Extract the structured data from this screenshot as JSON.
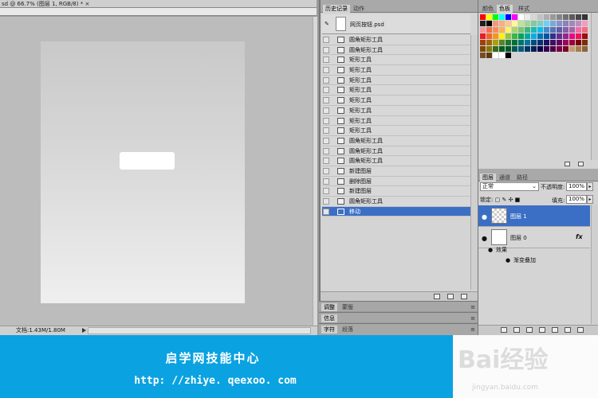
{
  "document": {
    "title": "sd @ 66.7% (图层 1, RGB/8) *",
    "close_glyph": "×",
    "status": "文档:1.43M/1.80M"
  },
  "history_panel": {
    "tabs": [
      "历史记录",
      "动作"
    ],
    "snapshot_label": "网页按钮.psd",
    "items": [
      {
        "label": "圆角矩形工具",
        "active": false
      },
      {
        "label": "圆角矩形工具",
        "active": false
      },
      {
        "label": "矩形工具",
        "active": false
      },
      {
        "label": "矩形工具",
        "active": false
      },
      {
        "label": "矩形工具",
        "active": false
      },
      {
        "label": "矩形工具",
        "active": false
      },
      {
        "label": "矩形工具",
        "active": false
      },
      {
        "label": "矩形工具",
        "active": false
      },
      {
        "label": "矩形工具",
        "active": false
      },
      {
        "label": "矩形工具",
        "active": false
      },
      {
        "label": "圆角矩形工具",
        "active": false
      },
      {
        "label": "圆角矩形工具",
        "active": false
      },
      {
        "label": "圆角矩形工具",
        "active": false
      },
      {
        "label": "新建图层",
        "active": false
      },
      {
        "label": "删除图层",
        "active": false
      },
      {
        "label": "新建图层",
        "active": false
      },
      {
        "label": "圆角矩形工具",
        "active": false
      },
      {
        "label": "移动",
        "active": true
      }
    ]
  },
  "collapsed_panels": [
    {
      "tabs": [
        "调整",
        "蒙版"
      ]
    },
    {
      "tabs": [
        "信息"
      ]
    },
    {
      "tabs": [
        "字符",
        "段落"
      ]
    }
  ],
  "swatch_panel": {
    "tabs": [
      "颜色",
      "色板",
      "样式"
    ],
    "colors": [
      "#ff0000",
      "#ffff00",
      "#00ff00",
      "#00ffff",
      "#0000ff",
      "#ff00ff",
      "#ffffff",
      "#ebebeb",
      "#d6d6d6",
      "#c2c2c2",
      "#adadad",
      "#999999",
      "#858585",
      "#707070",
      "#5c5c5c",
      "#474747",
      "#333333",
      "#1f1f1f",
      "#000000",
      "#f7977a",
      "#f9ad81",
      "#fdc68a",
      "#fff79a",
      "#c4df9b",
      "#a2d39c",
      "#82ca9d",
      "#7bcdc8",
      "#6ecff6",
      "#7ea7d8",
      "#8493ca",
      "#8882be",
      "#a187be",
      "#bc8dbf",
      "#f49ac2",
      "#f6989d",
      "#f26c4f",
      "#f68e55",
      "#fbaf5c",
      "#fff467",
      "#acd372",
      "#7cc576",
      "#3bb878",
      "#1abbb4",
      "#00bff3",
      "#438cca",
      "#5574b9",
      "#605ca8",
      "#855fa8",
      "#a763a8",
      "#f06ea9",
      "#f26d7d",
      "#ed1c24",
      "#f26522",
      "#f7941d",
      "#fff200",
      "#8dc73f",
      "#39b54a",
      "#00a651",
      "#00a99d",
      "#00aeef",
      "#0072bc",
      "#0054a6",
      "#2e3192",
      "#662d91",
      "#92278f",
      "#ec008c",
      "#ed145b",
      "#9e0b0f",
      "#a0410d",
      "#a36209",
      "#aba000",
      "#598527",
      "#1a7b30",
      "#007236",
      "#00746b",
      "#0076a3",
      "#004b80",
      "#003471",
      "#1b1464",
      "#440e62",
      "#630460",
      "#9e005d",
      "#9e0039",
      "#790000",
      "#7b2e00",
      "#7d4900",
      "#827b00",
      "#406618",
      "#005e20",
      "#005826",
      "#005952",
      "#005b7f",
      "#003663",
      "#002157",
      "#0d004c",
      "#32004b",
      "#4b0049",
      "#7b0046",
      "#7a0026",
      "#c69c6d",
      "#a67c52",
      "#8c6239",
      "#754c24",
      "#603913",
      "#ffffff",
      "#ffffff",
      "#000000"
    ]
  },
  "layers_panel": {
    "tabs": [
      "图层",
      "通道",
      "路径"
    ],
    "blend_mode": "正常",
    "opacity_label": "不透明度:",
    "opacity_value": "100%",
    "lock_label": "锁定:",
    "fill_label": "填充:",
    "fill_value": "100%",
    "layers": [
      {
        "name": "图层 1",
        "active": true,
        "fx": ""
      },
      {
        "name": "图层 0",
        "active": false,
        "fx": "fx"
      }
    ],
    "effects_label": "效果",
    "effect_item": "渐变叠加"
  },
  "banner": {
    "title": "启学网技能中心",
    "url": "http: //zhiye. qeexoo. com"
  },
  "watermark": {
    "logo": "Bai经验",
    "sub": "jingyan.baidu.com"
  }
}
